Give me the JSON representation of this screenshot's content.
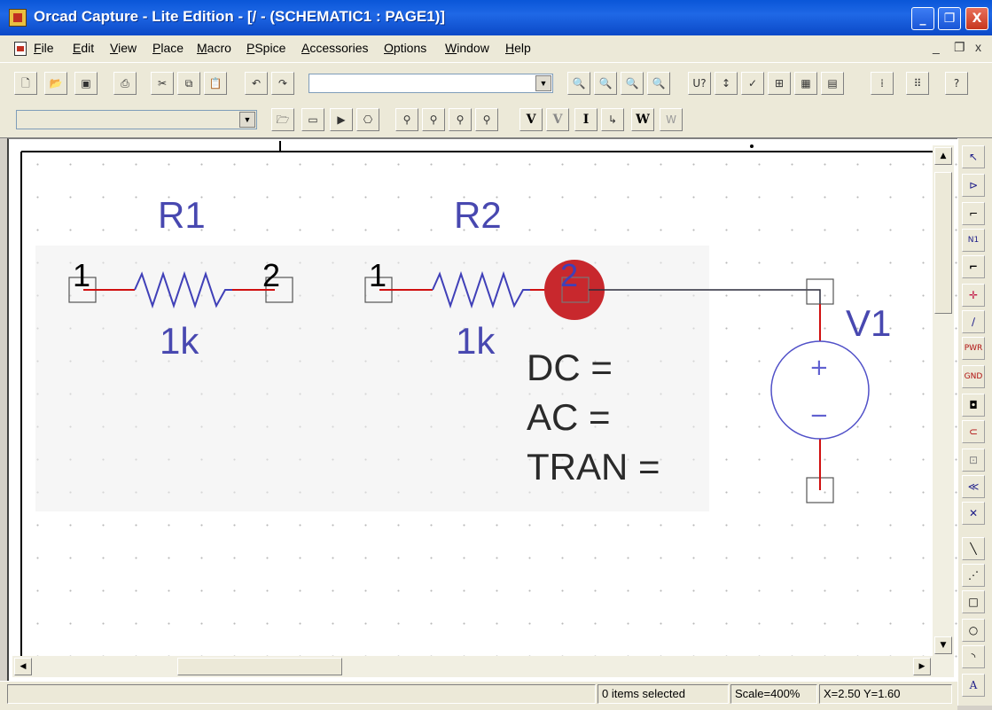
{
  "window": {
    "title": "Orcad Capture - Lite Edition - [/ - (SCHEMATIC1 : PAGE1)]",
    "minimize": "_",
    "maximize": "❐",
    "close": "X",
    "mdi_minimize": "_",
    "mdi_restore": "❐",
    "mdi_close": "x"
  },
  "menu": [
    "File",
    "Edit",
    "View",
    "Place",
    "Macro",
    "PSpice",
    "Accessories",
    "Options",
    "Window",
    "Help"
  ],
  "toolbar": {
    "part_combo_value": "",
    "sim_profile_value": "",
    "markers": {
      "voltage": "V",
      "voltage_diff": "V",
      "current": "I",
      "power": "W"
    }
  },
  "schematic": {
    "parts": [
      {
        "ref": "R1",
        "value": "1k",
        "pin1": "1",
        "pin2": "2"
      },
      {
        "ref": "R2",
        "value": "1k",
        "pin1": "1",
        "pin2": "2"
      },
      {
        "ref": "V1",
        "plus": "+",
        "minus": "−"
      }
    ],
    "source_props": [
      "DC =",
      "AC =",
      "TRAN ="
    ]
  },
  "palette": {
    "items": [
      "select-tool",
      "place-part",
      "place-wire",
      "net-alias",
      "place-bus",
      "junction",
      "bus-entry",
      "power",
      "ground",
      "hierarchical-block",
      "hierarchical-port",
      "off-page-connector",
      "no-connect",
      "no-connect-x",
      "place-line",
      "place-polyline",
      "place-rectangle",
      "place-ellipse",
      "place-arc",
      "place-text"
    ],
    "labels": {
      "power": "PWR",
      "ground": "GND",
      "text": "A",
      "net_alias": "N1"
    }
  },
  "status": {
    "selection": "0 items selected",
    "scale": "Scale=400%",
    "coords": "X=2.50  Y=1.60"
  },
  "colors": {
    "title_bar": "#0a56d8",
    "part_blue": "#4040b8",
    "pin_red": "#d01010",
    "highlight_red": "#c8282d",
    "v_source_stroke": "#5050c8"
  }
}
